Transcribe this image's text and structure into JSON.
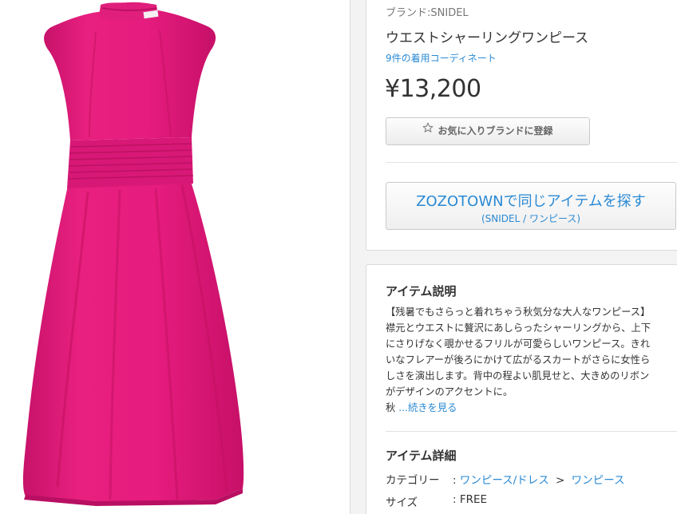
{
  "product": {
    "brand_text": "ブランド:SNIDEL",
    "name": "ウエストシャーリングワンピース",
    "coordinate_link": "9件の着用コーディネート",
    "price": "¥13,200",
    "favorite_button": "お気に入りブランドに登録",
    "zozo_button_main": "ZOZOTOWNで同じアイテムを探す",
    "zozo_button_sub": "(SNIDEL / ワンピース)",
    "dress_color": "#e61c7e"
  },
  "description": {
    "title": "アイテム説明",
    "lines": [
      "【残暑でもさらっと着れちゃう秋気分な大人なワンピース】",
      "襟元とウエストに贅沢にあしらったシャーリングから、上下",
      "にさりげなく覗かせるフリルが可愛らしいワンピース。きれ",
      "いなフレアーが後ろにかけて広がるスカートがさらに女性ら",
      "しさを演出します。背中の程よい肌見せと、大きめのリボン",
      "がデザインのアクセントに。"
    ],
    "last_line_prefix": "秋 ",
    "more_link": "...続きを見る"
  },
  "details": {
    "title": "アイテム詳細",
    "category_label": "カテゴリー",
    "category_value1": "ワンピース/ドレス",
    "category_sep": ">",
    "category_value2": "ワンピース",
    "size_label": "サイズ",
    "size_value": "FREE",
    "colon": ":"
  },
  "colors": {
    "link": "#2a8ad4",
    "panel_bg": "#f3f3f3"
  }
}
